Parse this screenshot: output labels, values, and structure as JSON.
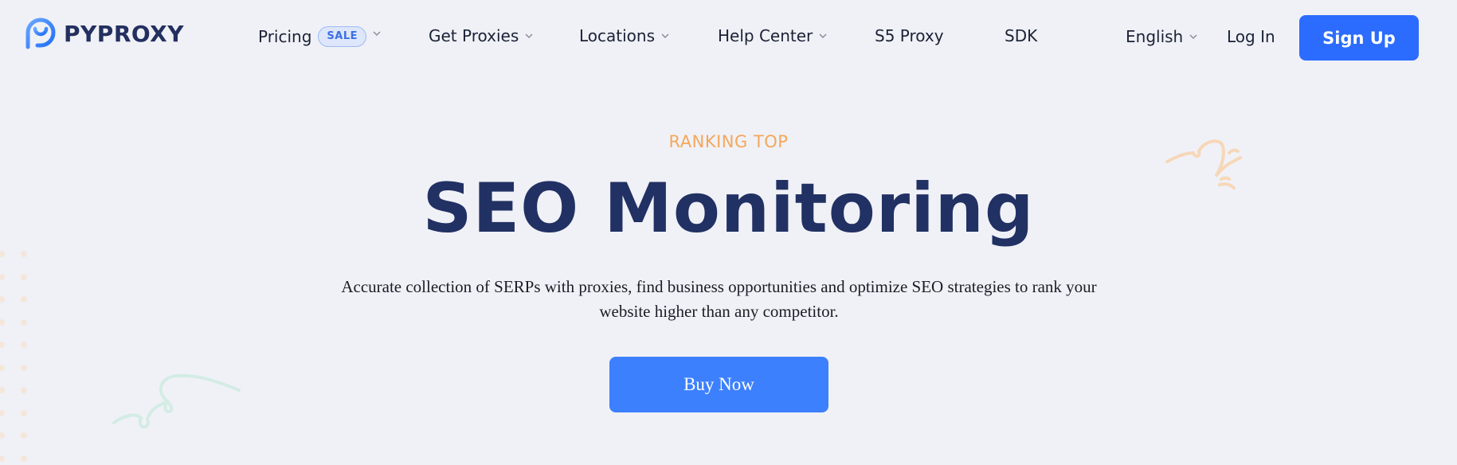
{
  "brand": {
    "name": "PYPROXY",
    "logo_icon": "pyproxy-logo-icon",
    "colors": {
      "primary": "#2b6cff",
      "button_blue": "#3d80fe",
      "navy": "#223163",
      "accent_orange": "#f5a75a",
      "background": "#f0f1f7"
    }
  },
  "nav": {
    "items": [
      {
        "label": "Pricing",
        "badge": "SALE",
        "has_dropdown": true
      },
      {
        "label": "Get Proxies",
        "has_dropdown": true
      },
      {
        "label": "Locations",
        "has_dropdown": true
      },
      {
        "label": "Help Center",
        "has_dropdown": true
      },
      {
        "label": "S5 Proxy",
        "has_dropdown": false
      },
      {
        "label": "SDK",
        "has_dropdown": false
      }
    ],
    "language": {
      "label": "English",
      "has_dropdown": true
    },
    "login_label": "Log In",
    "signup_label": "Sign Up"
  },
  "hero": {
    "eyebrow": "RANKING TOP",
    "title": "SEO Monitoring",
    "description": "Accurate collection of SERPs with proxies, find business opportunities and optimize SEO strategies to rank your website higher than any competitor.",
    "cta_label": "Buy Now"
  }
}
